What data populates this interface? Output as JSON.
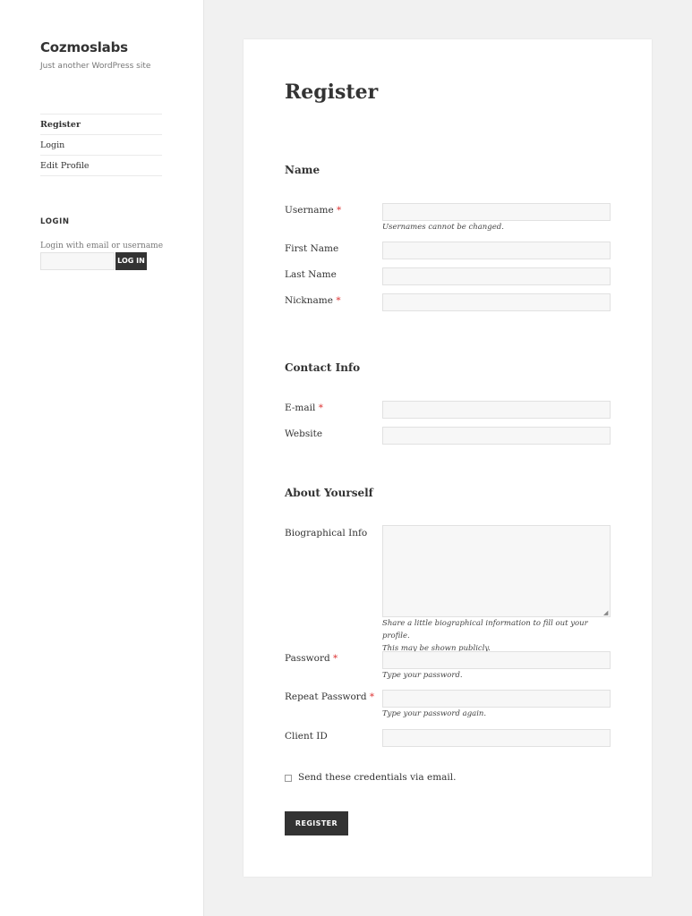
{
  "site": {
    "title": "Cozmoslabs",
    "description": "Just another WordPress site"
  },
  "nav": {
    "items": [
      {
        "label": "Register",
        "current": true
      },
      {
        "label": "Login",
        "current": false
      },
      {
        "label": "Edit Profile",
        "current": false
      }
    ]
  },
  "login_widget": {
    "title": "LOGIN",
    "label": "Login with email or username",
    "input_value": "",
    "button": "LOG IN"
  },
  "page": {
    "title": "Register"
  },
  "sections": {
    "name": "Name",
    "contact": "Contact Info",
    "about": "About Yourself"
  },
  "fields": {
    "username": {
      "label": "Username",
      "required": "*",
      "value": "",
      "hint": "Usernames cannot be changed."
    },
    "first_name": {
      "label": "First Name",
      "value": ""
    },
    "last_name": {
      "label": "Last Name",
      "value": ""
    },
    "nickname": {
      "label": "Nickname",
      "required": "*",
      "value": ""
    },
    "email": {
      "label": "E-mail",
      "required": "*",
      "value": ""
    },
    "website": {
      "label": "Website",
      "value": ""
    },
    "bio": {
      "label": "Biographical Info",
      "value": "",
      "hint_line1": "Share a little biographical information to fill out your profile.",
      "hint_line2": "This may be shown publicly."
    },
    "password": {
      "label": "Password",
      "required": "*",
      "value": "",
      "hint": "Type your password."
    },
    "repeat_password": {
      "label": "Repeat Password",
      "required": "*",
      "value": "",
      "hint": "Type your password again."
    },
    "client_id": {
      "label": "Client ID",
      "value": ""
    }
  },
  "send_credentials": {
    "label": "Send these credentials via email.",
    "checked": false
  },
  "submit": {
    "label": "REGISTER"
  },
  "icons": {
    "resize": "resize-handle-icon",
    "checkbox": "checkbox-icon"
  },
  "colors": {
    "background": "#f1f1f1",
    "card": "#ffffff",
    "button": "#333333",
    "required": "#dd3333"
  }
}
